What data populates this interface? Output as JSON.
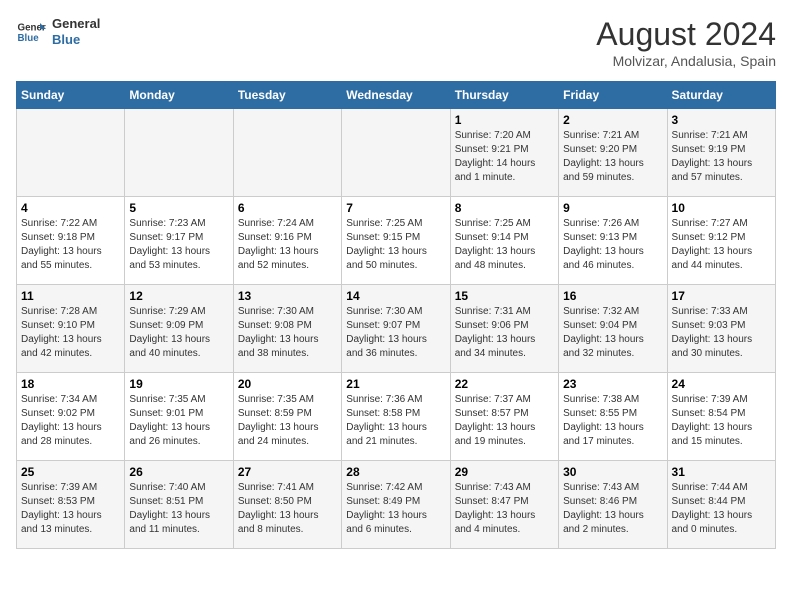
{
  "header": {
    "logo_line1": "General",
    "logo_line2": "Blue",
    "title": "August 2024",
    "subtitle": "Molvizar, Andalusia, Spain"
  },
  "calendar": {
    "headers": [
      "Sunday",
      "Monday",
      "Tuesday",
      "Wednesday",
      "Thursday",
      "Friday",
      "Saturday"
    ],
    "weeks": [
      [
        {
          "day": "",
          "info": ""
        },
        {
          "day": "",
          "info": ""
        },
        {
          "day": "",
          "info": ""
        },
        {
          "day": "",
          "info": ""
        },
        {
          "day": "1",
          "info": "Sunrise: 7:20 AM\nSunset: 9:21 PM\nDaylight: 14 hours\nand 1 minute."
        },
        {
          "day": "2",
          "info": "Sunrise: 7:21 AM\nSunset: 9:20 PM\nDaylight: 13 hours\nand 59 minutes."
        },
        {
          "day": "3",
          "info": "Sunrise: 7:21 AM\nSunset: 9:19 PM\nDaylight: 13 hours\nand 57 minutes."
        }
      ],
      [
        {
          "day": "4",
          "info": "Sunrise: 7:22 AM\nSunset: 9:18 PM\nDaylight: 13 hours\nand 55 minutes."
        },
        {
          "day": "5",
          "info": "Sunrise: 7:23 AM\nSunset: 9:17 PM\nDaylight: 13 hours\nand 53 minutes."
        },
        {
          "day": "6",
          "info": "Sunrise: 7:24 AM\nSunset: 9:16 PM\nDaylight: 13 hours\nand 52 minutes."
        },
        {
          "day": "7",
          "info": "Sunrise: 7:25 AM\nSunset: 9:15 PM\nDaylight: 13 hours\nand 50 minutes."
        },
        {
          "day": "8",
          "info": "Sunrise: 7:25 AM\nSunset: 9:14 PM\nDaylight: 13 hours\nand 48 minutes."
        },
        {
          "day": "9",
          "info": "Sunrise: 7:26 AM\nSunset: 9:13 PM\nDaylight: 13 hours\nand 46 minutes."
        },
        {
          "day": "10",
          "info": "Sunrise: 7:27 AM\nSunset: 9:12 PM\nDaylight: 13 hours\nand 44 minutes."
        }
      ],
      [
        {
          "day": "11",
          "info": "Sunrise: 7:28 AM\nSunset: 9:10 PM\nDaylight: 13 hours\nand 42 minutes."
        },
        {
          "day": "12",
          "info": "Sunrise: 7:29 AM\nSunset: 9:09 PM\nDaylight: 13 hours\nand 40 minutes."
        },
        {
          "day": "13",
          "info": "Sunrise: 7:30 AM\nSunset: 9:08 PM\nDaylight: 13 hours\nand 38 minutes."
        },
        {
          "day": "14",
          "info": "Sunrise: 7:30 AM\nSunset: 9:07 PM\nDaylight: 13 hours\nand 36 minutes."
        },
        {
          "day": "15",
          "info": "Sunrise: 7:31 AM\nSunset: 9:06 PM\nDaylight: 13 hours\nand 34 minutes."
        },
        {
          "day": "16",
          "info": "Sunrise: 7:32 AM\nSunset: 9:04 PM\nDaylight: 13 hours\nand 32 minutes."
        },
        {
          "day": "17",
          "info": "Sunrise: 7:33 AM\nSunset: 9:03 PM\nDaylight: 13 hours\nand 30 minutes."
        }
      ],
      [
        {
          "day": "18",
          "info": "Sunrise: 7:34 AM\nSunset: 9:02 PM\nDaylight: 13 hours\nand 28 minutes."
        },
        {
          "day": "19",
          "info": "Sunrise: 7:35 AM\nSunset: 9:01 PM\nDaylight: 13 hours\nand 26 minutes."
        },
        {
          "day": "20",
          "info": "Sunrise: 7:35 AM\nSunset: 8:59 PM\nDaylight: 13 hours\nand 24 minutes."
        },
        {
          "day": "21",
          "info": "Sunrise: 7:36 AM\nSunset: 8:58 PM\nDaylight: 13 hours\nand 21 minutes."
        },
        {
          "day": "22",
          "info": "Sunrise: 7:37 AM\nSunset: 8:57 PM\nDaylight: 13 hours\nand 19 minutes."
        },
        {
          "day": "23",
          "info": "Sunrise: 7:38 AM\nSunset: 8:55 PM\nDaylight: 13 hours\nand 17 minutes."
        },
        {
          "day": "24",
          "info": "Sunrise: 7:39 AM\nSunset: 8:54 PM\nDaylight: 13 hours\nand 15 minutes."
        }
      ],
      [
        {
          "day": "25",
          "info": "Sunrise: 7:39 AM\nSunset: 8:53 PM\nDaylight: 13 hours\nand 13 minutes."
        },
        {
          "day": "26",
          "info": "Sunrise: 7:40 AM\nSunset: 8:51 PM\nDaylight: 13 hours\nand 11 minutes."
        },
        {
          "day": "27",
          "info": "Sunrise: 7:41 AM\nSunset: 8:50 PM\nDaylight: 13 hours\nand 8 minutes."
        },
        {
          "day": "28",
          "info": "Sunrise: 7:42 AM\nSunset: 8:49 PM\nDaylight: 13 hours\nand 6 minutes."
        },
        {
          "day": "29",
          "info": "Sunrise: 7:43 AM\nSunset: 8:47 PM\nDaylight: 13 hours\nand 4 minutes."
        },
        {
          "day": "30",
          "info": "Sunrise: 7:43 AM\nSunset: 8:46 PM\nDaylight: 13 hours\nand 2 minutes."
        },
        {
          "day": "31",
          "info": "Sunrise: 7:44 AM\nSunset: 8:44 PM\nDaylight: 13 hours\nand 0 minutes."
        }
      ]
    ]
  }
}
